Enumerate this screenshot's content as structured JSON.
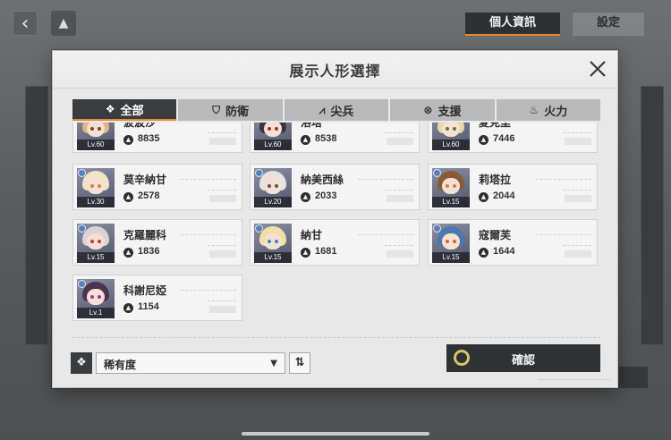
{
  "background": {
    "tabs": [
      {
        "label": "個人資訊",
        "active": true
      },
      {
        "label": "設定",
        "active": false
      }
    ]
  },
  "modal": {
    "title": "展示人形選擇",
    "tabs": [
      {
        "label": "全部",
        "icon": "diamond-cluster-icon",
        "active": true
      },
      {
        "label": "防衛",
        "icon": "shield-icon",
        "active": false
      },
      {
        "label": "尖兵",
        "icon": "spearhead-icon",
        "active": false
      },
      {
        "label": "支援",
        "icon": "support-ring-icon",
        "active": false
      },
      {
        "label": "火力",
        "icon": "fire-icon",
        "active": false
      }
    ],
    "dolls": [
      {
        "name": "波波沙",
        "level": "Lv.60",
        "power": "8835",
        "hair": "#d7b886",
        "eye": "#7a4a2a"
      },
      {
        "name": "洛塔",
        "level": "Lv.60",
        "power": "8538",
        "hair": "#3a3344",
        "eye": "#9a3040"
      },
      {
        "name": "夏克里",
        "level": "Lv.60",
        "power": "7446",
        "hair": "#e8d7a8",
        "eye": "#5a7a40"
      },
      {
        "name": "莫辛納甘",
        "level": "Lv.30",
        "power": "2578",
        "hair": "#efe6c8",
        "eye": "#c88a30"
      },
      {
        "name": "納美西絲",
        "level": "Lv.20",
        "power": "2033",
        "hair": "#e6e2e0",
        "eye": "#5a5060"
      },
      {
        "name": "莉塔拉",
        "level": "Lv.15",
        "power": "2044",
        "hair": "#8a5a38",
        "eye": "#d08040"
      },
      {
        "name": "克羅麗科",
        "level": "Lv.15",
        "power": "1836",
        "hair": "#d8d4d6",
        "eye": "#b04050"
      },
      {
        "name": "納甘",
        "level": "Lv.15",
        "power": "1681",
        "hair": "#f0e0a8",
        "eye": "#3a8ab0"
      },
      {
        "name": "寇爾芙",
        "level": "Lv.15",
        "power": "1644",
        "hair": "#4a78b0",
        "eye": "#c07030"
      },
      {
        "name": "科謝尼婭",
        "level": "Lv.1",
        "power": "1154",
        "hair": "#4a3450",
        "eye": "#8a40a0"
      }
    ],
    "sort": {
      "selected": "稀有度"
    },
    "confirm_label": "確認"
  }
}
